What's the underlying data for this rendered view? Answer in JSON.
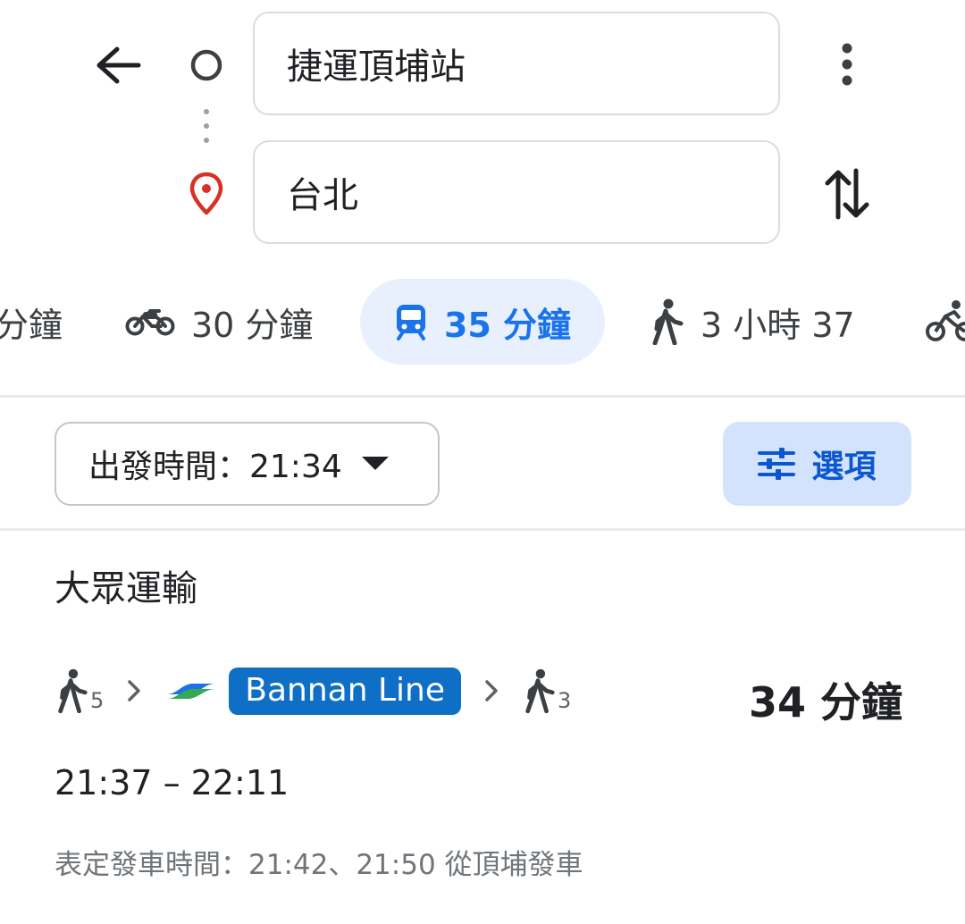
{
  "search": {
    "origin": "捷運頂埔站",
    "destination": "台北"
  },
  "modes": [
    {
      "name": "car",
      "label": "分鐘"
    },
    {
      "name": "motorcycle",
      "label": "30 分鐘"
    },
    {
      "name": "transit",
      "label": "35 分鐘",
      "selected": true
    },
    {
      "name": "walk",
      "label": "3 小時 37"
    },
    {
      "name": "bicycle",
      "label": ""
    }
  ],
  "options": {
    "depart_label": "出發時間：21:34",
    "options_label": "選項"
  },
  "results": {
    "section_title": "大眾運輸",
    "route": {
      "walk_before_minutes": "5",
      "line_name": "Bannan Line",
      "walk_after_minutes": "3",
      "duration": "34 分鐘",
      "time_range": "21:37 – 22:11",
      "schedule_text": "表定發車時間：21:42、21:50 從頂埔發車"
    }
  },
  "colors": {
    "accent": "#1a73e8",
    "selected_tab_bg": "#e8f0fe",
    "options_bg": "#d3e3fd",
    "line_badge": "#0f6fc6",
    "destination_pin": "#d93025",
    "line_logo_blue": "#1a73e8",
    "line_logo_green": "#34a853"
  },
  "icons": {
    "back": "arrow-left",
    "origin": "circle-outline",
    "destination": "map-pin",
    "more": "vertical-dots",
    "swap": "swap-vertical-arrows",
    "car": "car",
    "motorcycle": "motorcycle",
    "transit": "train",
    "walk": "walking-person",
    "bicycle": "bicycle",
    "dropdown": "triangle-down",
    "options": "tune-sliders",
    "chevron": "chevron-right",
    "line_logo": "metro-logo"
  }
}
